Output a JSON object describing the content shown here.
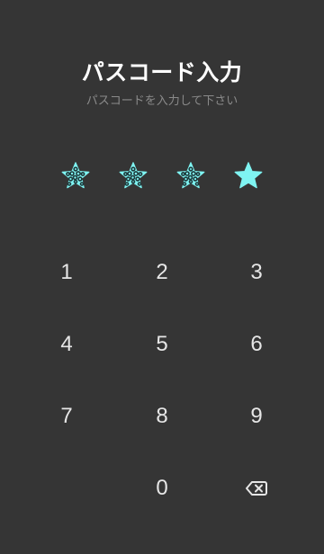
{
  "header": {
    "title": "パスコード入力",
    "subtitle": "パスコードを入力して下さい"
  },
  "passcode": {
    "length": 4,
    "filled": 3,
    "filled_icon": "leopard-pattern-star-icon",
    "empty_icon": "cyan-star-icon",
    "colors": {
      "star_cyan": "#7ff4f2",
      "star_pattern": "#1e3a3c"
    }
  },
  "keypad": {
    "keys": [
      "1",
      "2",
      "3",
      "4",
      "5",
      "6",
      "7",
      "8",
      "9",
      "",
      "0",
      ""
    ],
    "delete_icon": "backspace-icon"
  },
  "colors": {
    "background": "#353535",
    "title": "#ffffff",
    "subtitle": "#8a8a8a",
    "key_text": "#e6e6e6"
  }
}
